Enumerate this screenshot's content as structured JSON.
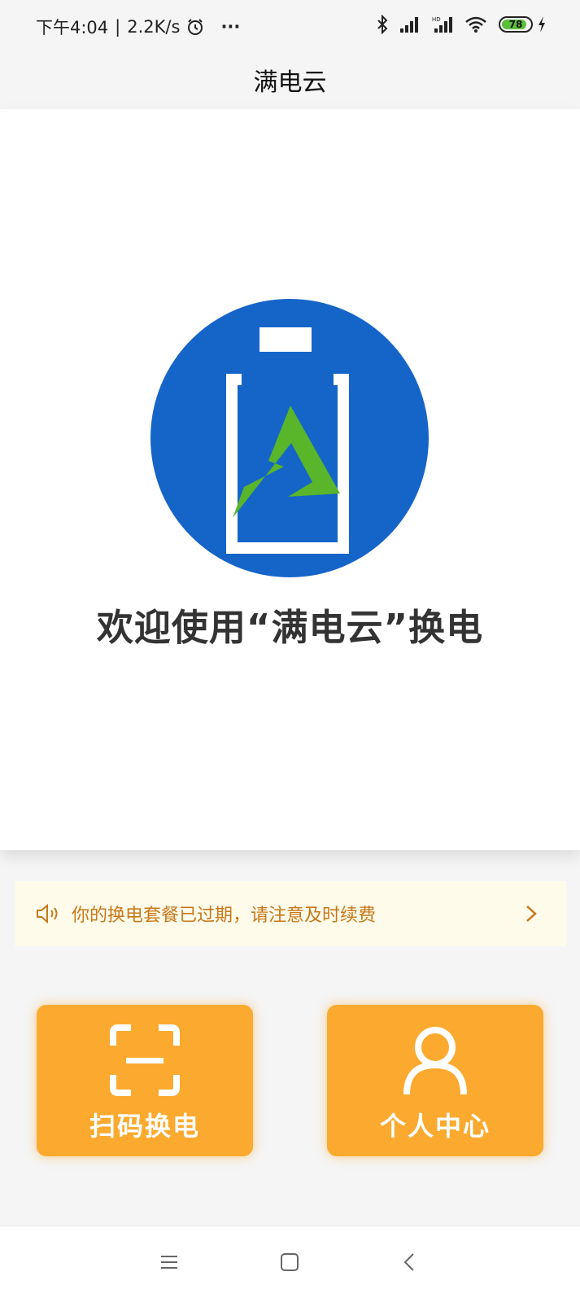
{
  "status_bar": {
    "time": "下午4:04",
    "separator": "|",
    "speed": "2.2K/s",
    "dots": "···",
    "battery_level": "78",
    "icons": [
      "alarm-icon",
      "bluetooth-icon",
      "signal-icon",
      "hd-signal-icon",
      "wifi-icon",
      "battery-icon",
      "charging-icon"
    ]
  },
  "header": {
    "title": "满电云"
  },
  "hero": {
    "welcome_text": "欢迎使用“满电云”换电",
    "logo_colors": {
      "circle": "#1565c8",
      "bolt": "#59b52a",
      "outline": "#ffffff"
    }
  },
  "notice": {
    "text": "你的换电套餐已过期，请注意及时续费",
    "icon": "speaker-icon",
    "color": "#c77818"
  },
  "actions": [
    {
      "label": "扫码换电",
      "icon": "scan-icon"
    },
    {
      "label": "个人中心",
      "icon": "user-icon"
    }
  ],
  "accent_color": "#fbaa2f",
  "nav": {
    "icons": [
      "menu-icon",
      "home-icon",
      "back-icon"
    ]
  }
}
